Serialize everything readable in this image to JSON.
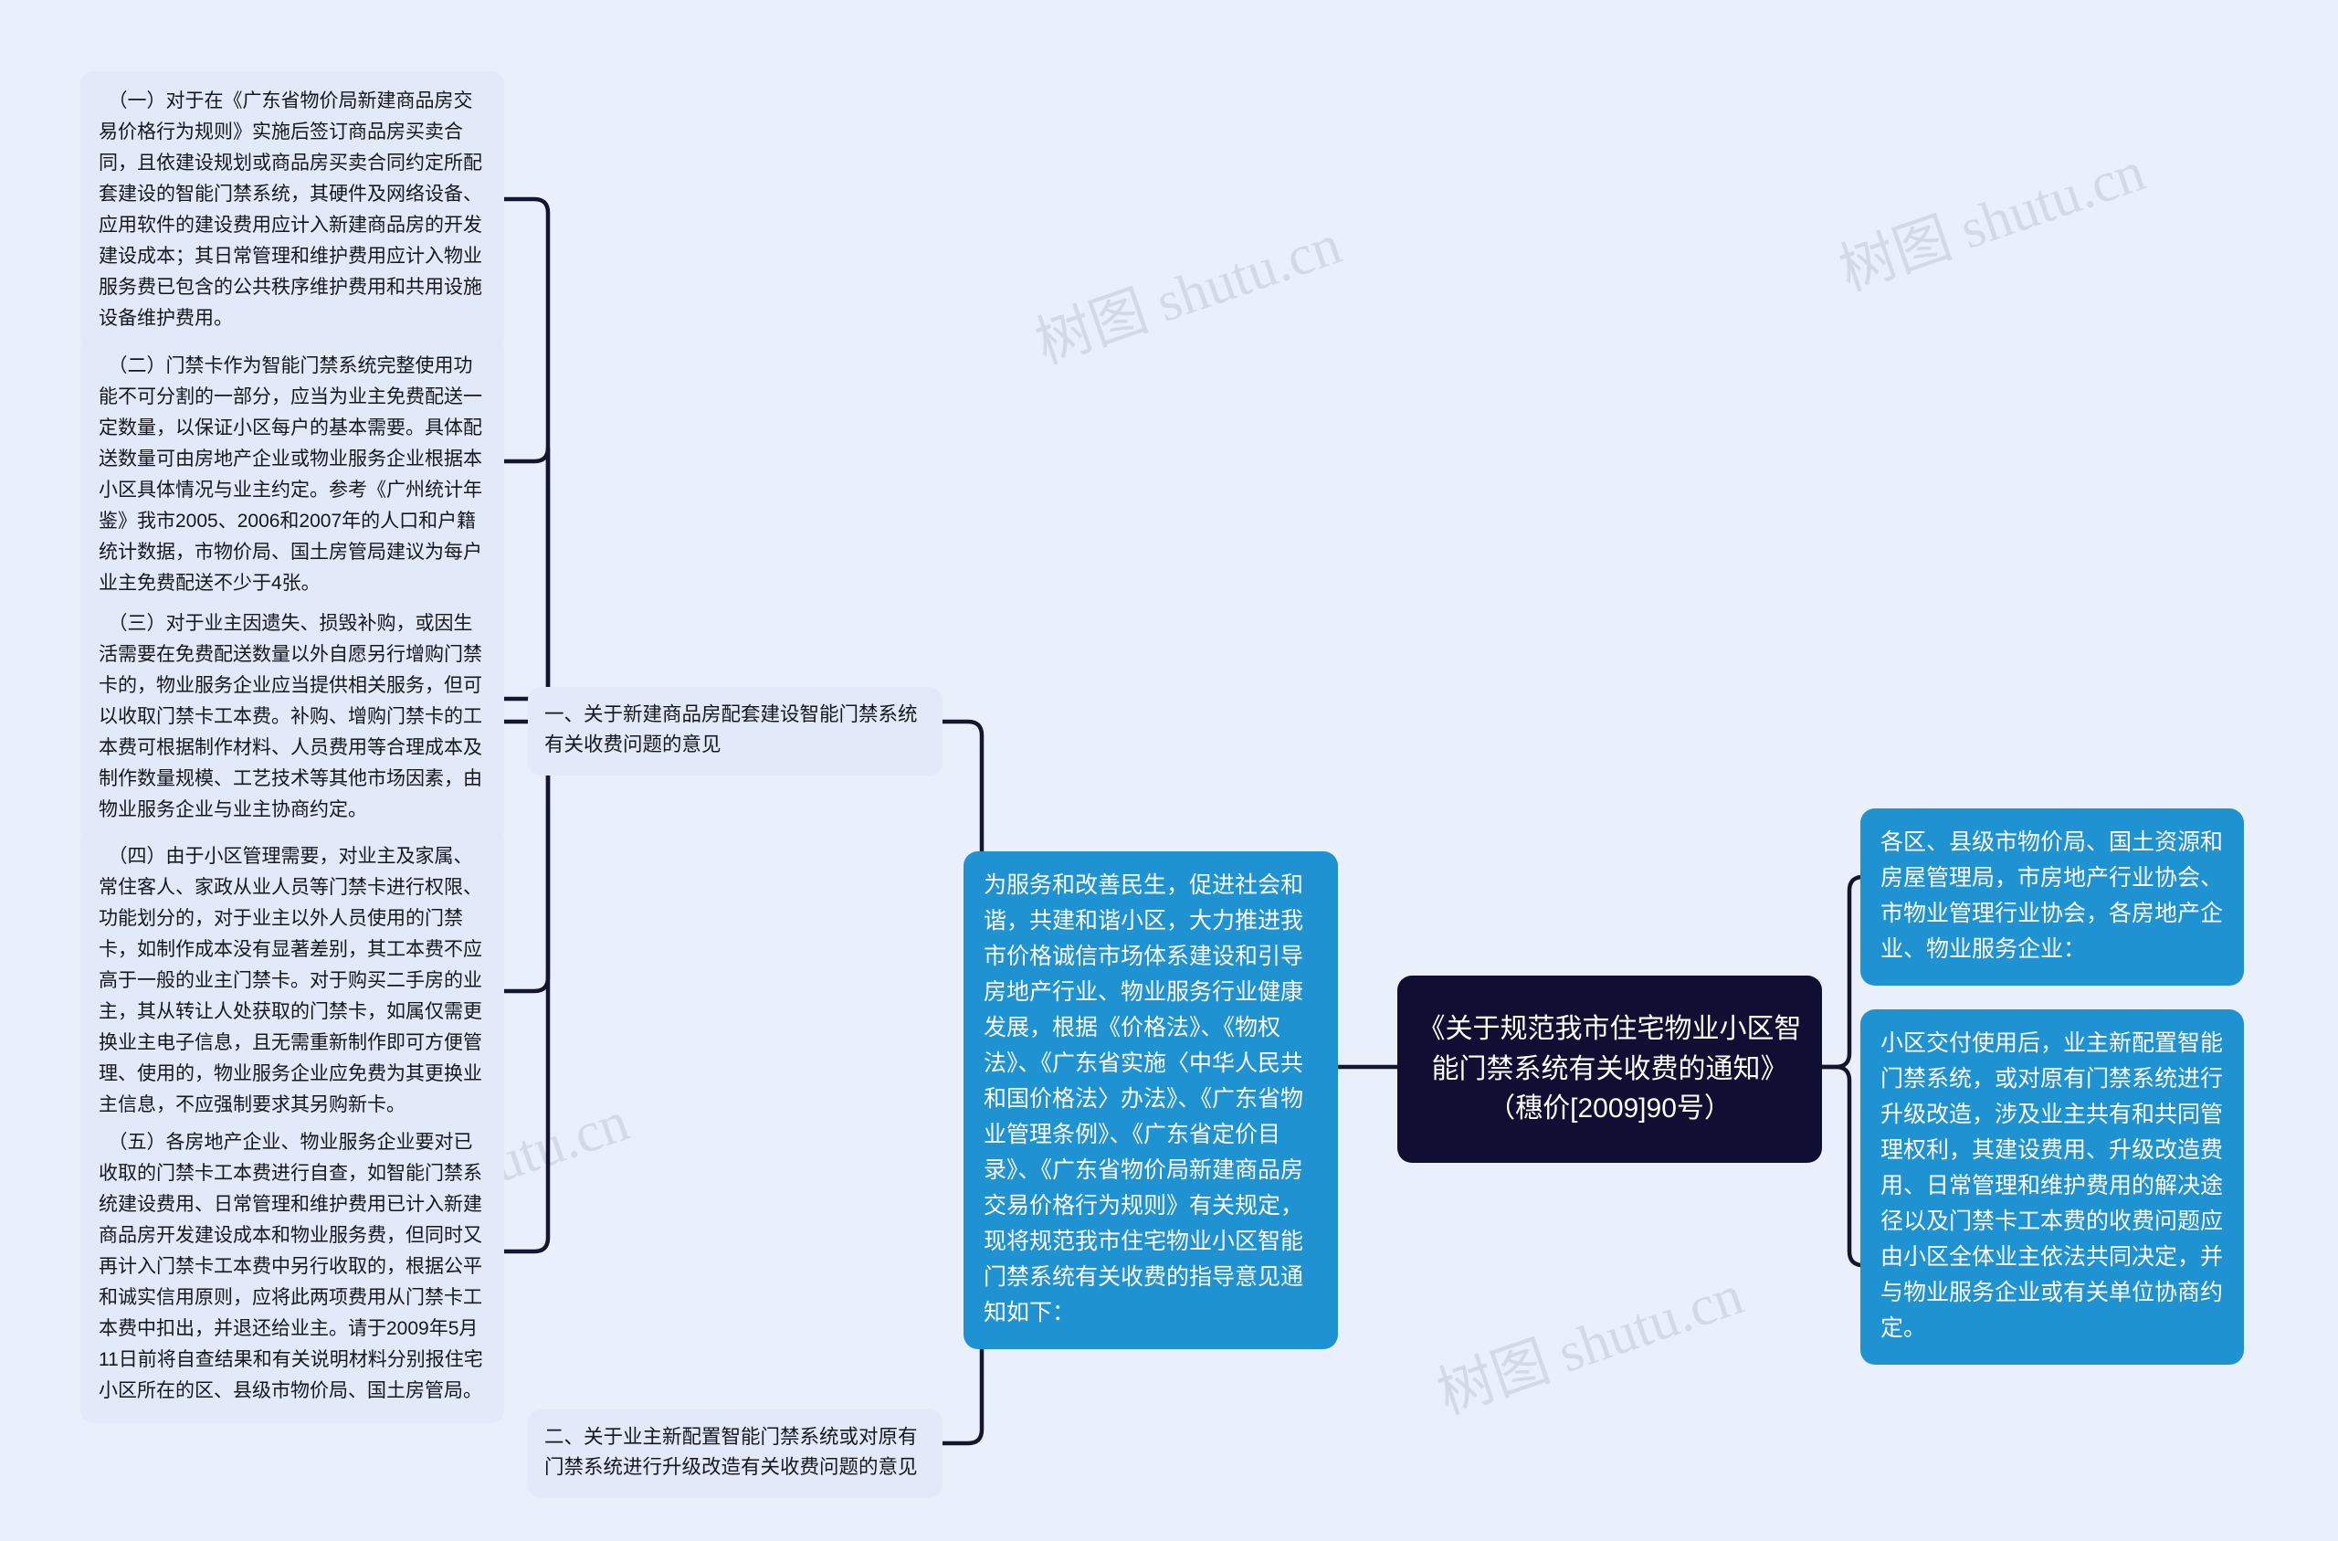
{
  "diagram": {
    "background_color": "#eaf0fb",
    "accent_blue": "#1f92d2",
    "root_color": "#100f33",
    "leaf_color": "#e2e9f9",
    "connector_color": "#15152e",
    "watermark_text": "树图 shutu.cn"
  },
  "root": {
    "title": "《关于规范我市住宅物业小区智能门禁系统有关收费的通知》（穗价[2009]90号）"
  },
  "intro": {
    "text": "为服务和改善民生，促进社会和谐，共建和谐小区，大力推进我市价格诚信市场体系建设和引导房地产行业、物业服务行业健康发展，根据《价格法》、《物权法》、《广东省实施〈中华人民共和国价格法〉办法》、《广东省物业管理条例》、《广东省定价目录》、《广东省物价局新建商品房交易价格行为规则》有关规定，现将规范我市住宅物业小区智能门禁系统有关收费的指导意见通知如下："
  },
  "right_branches": [
    {
      "id": "recipients",
      "text": "各区、县级市物价局、国土资源和房屋管理局，市房地产行业协会、市物业管理行业协会，各房地产企业、物业服务企业："
    },
    {
      "id": "section-two-detail",
      "text": "小区交付使用后，业主新配置智能门禁系统，或对原有门禁系统进行升级改造，涉及业主共有和共同管理权利，其建设费用、升级改造费用、日常管理和维护费用的解决途径以及门禁卡工本费的收费问题应由小区全体业主依法共同决定，并与物业服务企业或有关单位协商约定。"
    }
  ],
  "left_branches": [
    {
      "id": "section-one",
      "label": "一、关于新建商品房配套建设智能门禁系统有关收费问题的意见"
    },
    {
      "id": "section-two",
      "label": "二、关于业主新配置智能门禁系统或对原有门禁系统进行升级改造有关收费问题的意见"
    }
  ],
  "section_one_items": [
    {
      "id": "item-1",
      "text": "　（一）对于在《广东省物价局新建商品房交易价格行为规则》实施后签订商品房买卖合同，且依建设规划或商品房买卖合同约定所配套建设的智能门禁系统，其硬件及网络设备、应用软件的建设费用应计入新建商品房的开发建设成本；其日常管理和维护费用应计入物业服务费已包含的公共秩序维护费用和共用设施设备维护费用。"
    },
    {
      "id": "item-2",
      "text": "　（二）门禁卡作为智能门禁系统完整使用功能不可分割的一部分，应当为业主免费配送一定数量，以保证小区每户的基本需要。具体配送数量可由房地产企业或物业服务企业根据本小区具体情况与业主约定。参考《广州统计年鉴》我市2005、2006和2007年的人口和户籍统计数据，市物价局、国土房管局建议为每户业主免费配送不少于4张。"
    },
    {
      "id": "item-3",
      "text": "　（三）对于业主因遗失、损毁补购，或因生活需要在免费配送数量以外自愿另行增购门禁卡的，物业服务企业应当提供相关服务，但可以收取门禁卡工本费。补购、增购门禁卡的工本费可根据制作材料、人员费用等合理成本及制作数量规模、工艺技术等其他市场因素，由物业服务企业与业主协商约定。"
    },
    {
      "id": "item-4",
      "text": "　（四）由于小区管理需要，对业主及家属、常住客人、家政从业人员等门禁卡进行权限、功能划分的，对于业主以外人员使用的门禁卡，如制作成本没有显著差别，其工本费不应高于一般的业主门禁卡。对于购买二手房的业主，其从转让人处获取的门禁卡，如属仅需更换业主电子信息，且无需重新制作即可方便管理、使用的，物业服务企业应免费为其更换业主信息，不应强制要求其另购新卡。"
    },
    {
      "id": "item-5",
      "text": "　（五）各房地产企业、物业服务企业要对已收取的门禁卡工本费进行自查，如智能门禁系统建设费用、日常管理和维护费用已计入新建商品房开发建设成本和物业服务费，但同时又再计入门禁卡工本费中另行收取的，根据公平和诚实信用原则，应将此两项费用从门禁卡工本费中扣出，并退还给业主。请于2009年5月11日前将自查结果和有关说明材料分别报住宅小区所在的区、县级市物价局、国土房管局。"
    }
  ]
}
